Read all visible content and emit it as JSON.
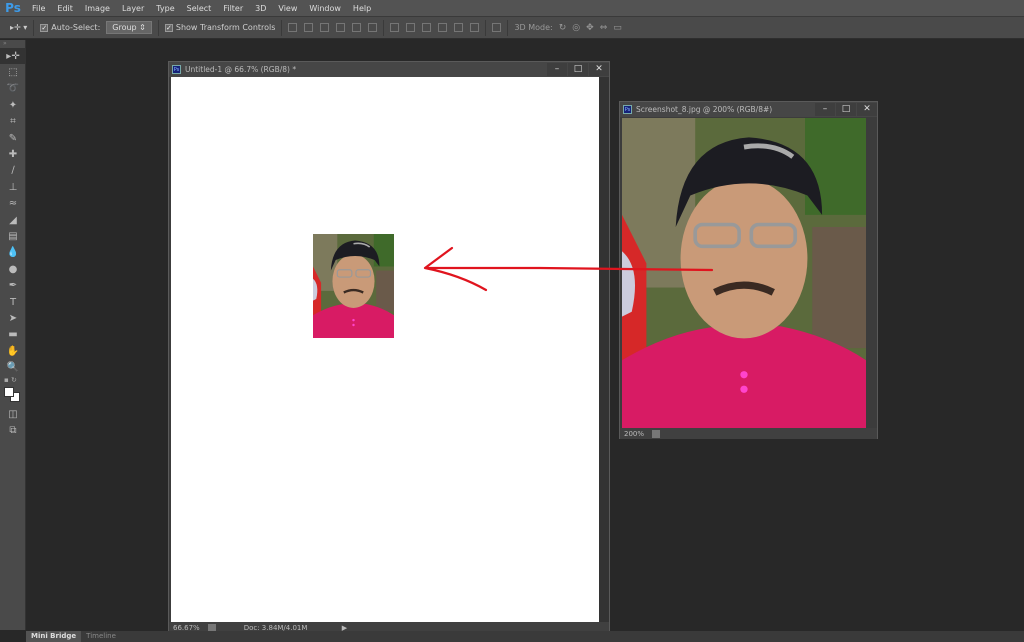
{
  "app": {
    "logo": "Ps"
  },
  "menu": [
    "File",
    "Edit",
    "Image",
    "Layer",
    "Type",
    "Select",
    "Filter",
    "3D",
    "View",
    "Window",
    "Help"
  ],
  "options": {
    "auto_select_label": "Auto-Select:",
    "auto_select_checked": true,
    "auto_select_value": "Group",
    "show_transform_label": "Show Transform Controls",
    "show_transform_checked": true,
    "mode_3d_label": "3D Mode:"
  },
  "tools": [
    "move",
    "marquee",
    "lasso",
    "magic-wand",
    "crop",
    "eyedropper",
    "healing",
    "brush",
    "stamp",
    "history-brush",
    "eraser",
    "gradient",
    "blur",
    "dodge",
    "pen",
    "type",
    "path-select",
    "rectangle",
    "hand",
    "zoom"
  ],
  "documents": [
    {
      "title": "Untitled-1 @ 66.7% (RGB/8) *",
      "zoom": "66.67%",
      "doc_info": "Doc: 3.84M/4.01M"
    },
    {
      "title": "Screenshot_8.jpg @ 200% (RGB/8#)",
      "zoom": "200%"
    }
  ],
  "panels": [
    "Mini Bridge",
    "Timeline"
  ],
  "colors": {
    "arrow": "#e0141e",
    "shirt": "#d81b64",
    "accent": "#3d9be9"
  }
}
